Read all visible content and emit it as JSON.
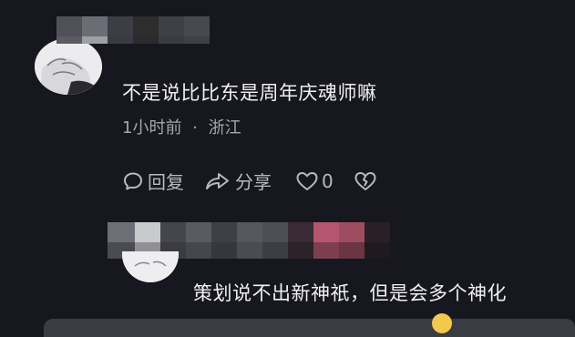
{
  "comment1": {
    "username_blurred": "",
    "text": "不是说比比东是周年庆魂师嘛",
    "time": "1小时前",
    "separator": "·",
    "location": "浙江",
    "actions": {
      "reply_label": "回复",
      "share_label": "分享",
      "like_count": "0"
    }
  },
  "comment2": {
    "username_blurred": "",
    "text": "策划说不出新神祇，但是会多个神化"
  },
  "colors": {
    "background": "#16171f",
    "text_primary": "#f0f0f2",
    "text_secondary": "#a7a8ae"
  },
  "icons": [
    "comment-bubble-icon",
    "share-arrow-icon",
    "heart-icon",
    "broken-heart-icon"
  ]
}
